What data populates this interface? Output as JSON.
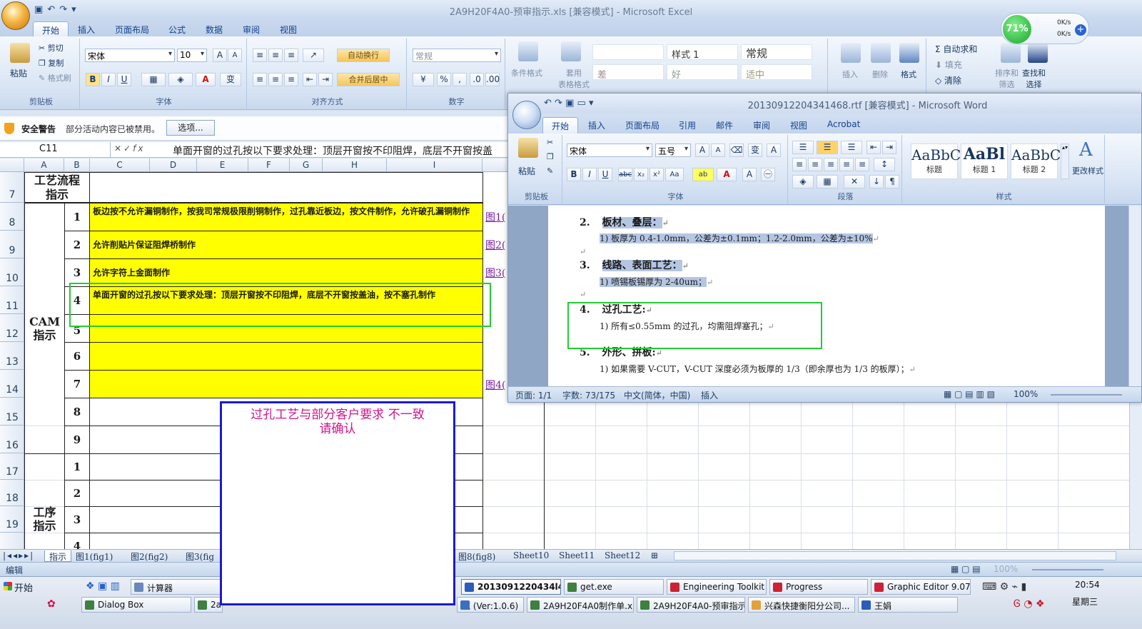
{
  "excel": {
    "title": "2A9H20F4A0-预审指示.xls  [兼容模式] - Microsoft Excel",
    "orb_label": "",
    "tabs": [
      "开始",
      "插入",
      "页面布局",
      "公式",
      "数据",
      "审阅",
      "视图"
    ],
    "clipboard": {
      "paste": "粘贴",
      "cut": "剪切",
      "copy": "复制",
      "format_painter": "格式刷",
      "group": "剪贴板"
    },
    "font": {
      "name": "宋体",
      "size": "10",
      "group": "字体"
    },
    "alignment": {
      "wrap": "自动换行",
      "merge": "合并后居中",
      "group": "对齐方式"
    },
    "number": {
      "format": "常规",
      "group": "数字"
    },
    "styles": {
      "cond_format": "条件格式",
      "table_format": "套用\n表格格式",
      "style1": "样式 1",
      "normal": "常规",
      "bad": "差",
      "good": "好",
      "neutral": "适中"
    },
    "cells": {
      "insert": "插入",
      "delete": "删除",
      "format": "格式"
    },
    "editing": {
      "autosum": "自动求和",
      "fill": "填充",
      "clear": "清除",
      "sort": "排序和\n筛选",
      "find": "查找和\n选择"
    },
    "security": {
      "title": "安全警告",
      "message": "部分活动内容已被禁用。",
      "options": "选项..."
    },
    "name_box": "C11",
    "formula": "单面开窗的过孔按以下要求处理：顶层开窗按不印阻焊，底层不开窗按盖",
    "columns": [
      "A",
      "B",
      "C",
      "D",
      "E",
      "F",
      "G",
      "H",
      "I"
    ],
    "rows": [
      "7",
      "8",
      "9",
      "10",
      "11",
      "12",
      "13",
      "14",
      "15",
      "16",
      "17",
      "18",
      "19"
    ],
    "header_cell": "工艺流程\n指示",
    "cam_label": "CAM\n指示",
    "process_label": "工序\n指示",
    "cam_items": [
      {
        "n": "1",
        "text": "板边按不允许漏铜制作，按我司常规极限削铜制作，过孔靠近板边，按文件制作，允许破孔漏铜制作",
        "link": "图1("
      },
      {
        "n": "2",
        "text": "允许削贴片保证阻焊桥制作",
        "link": "图2("
      },
      {
        "n": "3",
        "text": "允许字符上金面制作",
        "link": "图3("
      },
      {
        "n": "4",
        "text": "单面开窗的过孔按以下要求处理：顶层开窗按不印阻焊，底层不开窗按盖油，按不塞孔制作",
        "link": ""
      },
      {
        "n": "5",
        "text": "",
        "link": ""
      },
      {
        "n": "6",
        "text": "",
        "link": ""
      },
      {
        "n": "7",
        "text": "",
        "link": "图4("
      },
      {
        "n": "8",
        "text": "",
        "link": ""
      },
      {
        "n": "9",
        "text": "",
        "link": ""
      }
    ],
    "process_items": [
      "1",
      "2",
      "3",
      "4"
    ],
    "sheet_tabs": [
      "指示",
      "图1(fig1)",
      "图2(fig2)",
      "图3(fig",
      "图8(fig8)",
      "Sheet10",
      "Sheet11",
      "Sheet12"
    ],
    "status": "编辑",
    "zoom": "100%"
  },
  "note": {
    "line1": "过孔工艺与部分客户要求 不一致",
    "line2": "请确认"
  },
  "network": {
    "percent": "71%",
    "up": "0K/s",
    "down": "0K/s"
  },
  "word": {
    "title": "20130912204341468.rtf [兼容模式] - Microsoft Word",
    "tabs": [
      "开始",
      "插入",
      "页面布局",
      "引用",
      "邮件",
      "审阅",
      "视图",
      "Acrobat"
    ],
    "clipboard": {
      "paste": "粘贴",
      "group": "剪贴板"
    },
    "font": {
      "name": "宋体",
      "size": "五号",
      "group": "字体"
    },
    "paragraph_group": "段落",
    "styles": [
      {
        "preview": "AaBbC",
        "label": "标题"
      },
      {
        "preview": "AaBl",
        "label": "标题 1"
      },
      {
        "preview": "AaBbC",
        "label": "标题 2"
      }
    ],
    "change_styles": "更改样式",
    "styles_group": "样式",
    "doc": [
      {
        "num": "2.",
        "title": "板材、叠层：",
        "sub": "1)  板厚为 0.4-1.0mm，公差为±0.1mm；1.2-2.0mm，公差为±10%"
      },
      {
        "num": "3.",
        "title": "线路、表面工艺：",
        "sub": "1)  喷锡板锡厚为 2-40um；"
      },
      {
        "num": "4.",
        "title": "过孔工艺:",
        "sub": "1)  所有≤0.55mm 的过孔，均需阻焊塞孔；"
      },
      {
        "num": "5.",
        "title": "外形、拼板:",
        "sub": "1)  如果需要 V-CUT，V-CUT 深度必须为板厚的 1/3（即余厚也为 1/3 的板厚）；"
      }
    ],
    "status": {
      "page": "页面: 1/1",
      "words": "字数: 73/175",
      "lang": "中文(简体，中国)",
      "mode": "插入",
      "zoom": "100%"
    }
  },
  "taskbar": {
    "start": "开始",
    "row1": [
      "计算器",
      "2013091220434l4...",
      "get.exe",
      "Engineering Toolkit 9....",
      "Progress",
      "Graphic Editor 9.07b2..."
    ],
    "row2": [
      "Dialog Box",
      "2a",
      "范 (Ver:1.0.6)",
      "2A9H20F4A0制作单.xls...",
      "2A9H20F4A0-预审指示...",
      "兴森快捷衡阳分公司...",
      "王娟"
    ],
    "time": "20:54",
    "day": "星期三"
  }
}
